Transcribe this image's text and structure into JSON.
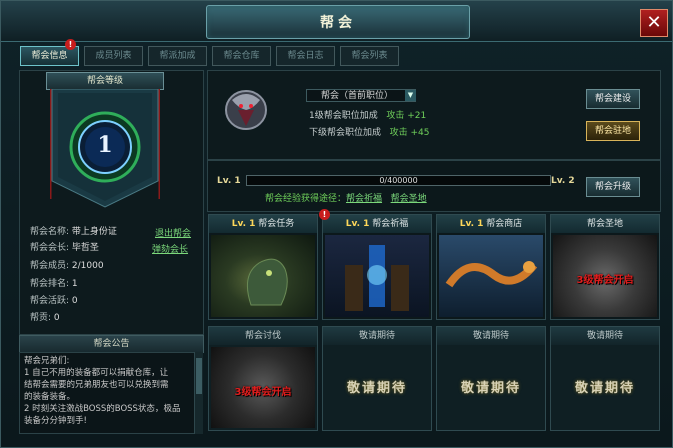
{
  "window": {
    "title": "帮会",
    "close_label": "✕"
  },
  "tabs": [
    {
      "label": "帮会信息",
      "active": true
    },
    {
      "label": "成员列表",
      "active": false
    },
    {
      "label": "帮派加成",
      "active": false
    },
    {
      "label": "帮会仓库",
      "active": false
    },
    {
      "label": "帮会日志",
      "active": false
    },
    {
      "label": "帮会列表",
      "active": false
    }
  ],
  "tab_badge": "!",
  "left": {
    "banner_title": "帮会等级",
    "level_number": "1",
    "info": [
      {
        "key": "帮会名称:",
        "value": "带上身份证"
      },
      {
        "key": "帮会会长:",
        "value": "毕哲圣"
      },
      {
        "key": "帮会成员:",
        "value": "2/1000"
      },
      {
        "key": "帮会排名:",
        "value": "1"
      },
      {
        "key": "帮会活跃:",
        "value": "0"
      },
      {
        "key": "帮贡:",
        "value": "0"
      }
    ],
    "quit_link": "退出帮会",
    "impeach_link": "弹劾会长",
    "notice_title": "帮会公告",
    "notice_lines": [
      "帮会兄弟们:",
      "1 自己不用的装备都可以捐献仓库，让",
      "结帮会需要的兄弟朋友也可以兑换到需",
      "的装备装备。",
      "2 时刻关注激战BOSS的BOSS状态，极品",
      "装备分分钟到手!"
    ]
  },
  "position": {
    "dropdown_value": "帮会（首前职位）",
    "bonus": [
      {
        "label": "1级帮会职位加成",
        "value": "攻击 +21"
      },
      {
        "label": "下级帮会职位加成",
        "value": "攻击 +45"
      }
    ],
    "build_button": "帮会建设",
    "home_button": "帮会驻地"
  },
  "level": {
    "current_label": "Lv. 1",
    "next_label": "Lv. 2",
    "progress_text": "0/400000",
    "progress_fraction": 0,
    "routes_prefix": "帮会经验获得途径：",
    "route_links": [
      "帮会祈福",
      "帮会圣地"
    ],
    "upgrade_button": "帮会升级"
  },
  "cards_row1": [
    {
      "lv": "Lv. 1",
      "title": "帮会任务",
      "badge": "",
      "overlay": ""
    },
    {
      "lv": "Lv. 1",
      "title": "帮会祈福",
      "badge": "!",
      "overlay": ""
    },
    {
      "lv": "Lv. 1",
      "title": "帮会商店",
      "badge": "",
      "overlay": ""
    },
    {
      "lv": "",
      "title": "帮会圣地",
      "badge": "",
      "overlay": "3级帮会开启"
    }
  ],
  "cards_row2": [
    {
      "title": "帮会讨伐",
      "overlay": "3级帮会开启",
      "placeholder": ""
    },
    {
      "title": "敬请期待",
      "overlay": "",
      "placeholder": "敬请期待"
    },
    {
      "title": "敬请期待",
      "overlay": "",
      "placeholder": "敬请期待"
    },
    {
      "title": "敬请期待",
      "overlay": "",
      "placeholder": "敬请期待"
    }
  ],
  "colors": {
    "accent": "#6ec3ca",
    "link": "#7bd87b",
    "level_gold": "#ffd85a",
    "alert": "#e21d1d"
  }
}
